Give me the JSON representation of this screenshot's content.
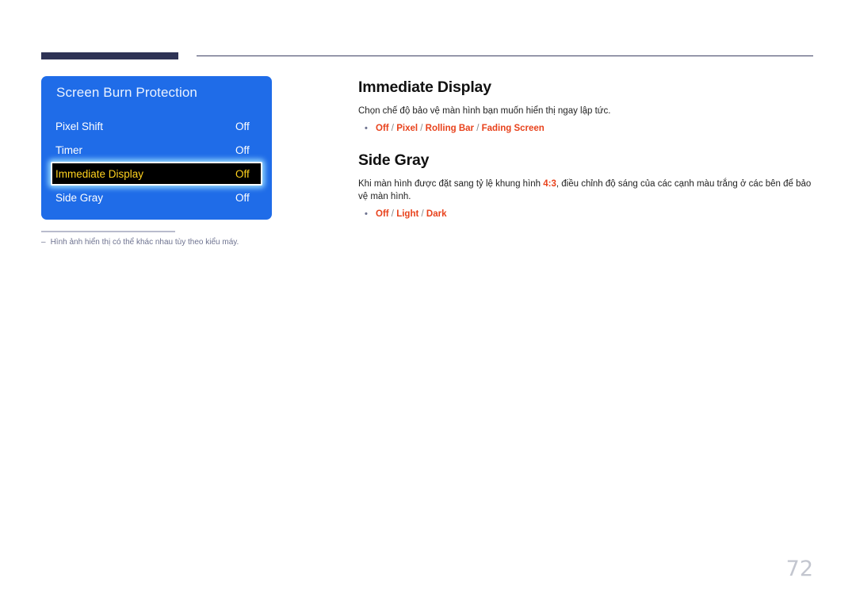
{
  "page": {
    "number": "72"
  },
  "osd": {
    "title": "Screen Burn Protection",
    "items": [
      {
        "label": "Pixel Shift",
        "value": "Off",
        "selected": false
      },
      {
        "label": "Timer",
        "value": "Off",
        "selected": false
      },
      {
        "label": "Immediate Display",
        "value": "Off",
        "selected": true
      },
      {
        "label": "Side Gray",
        "value": "Off",
        "selected": false
      }
    ],
    "colors": {
      "panel_blue": "#1f6ce8",
      "selected_background": "#000000",
      "selected_text": "#ffd21e",
      "selected_border": "#ffffff"
    }
  },
  "note": {
    "dash": "–",
    "text": "Hình ảnh hiển thị có thể khác nhau tùy theo kiểu máy."
  },
  "sections": [
    {
      "heading": "Immediate Display",
      "body_before": "Chọn chế độ bảo vệ màn hình bạn muốn hiển thị ngay lập tức.",
      "body_highlight": "",
      "body_after": "",
      "bullet": "•",
      "options": [
        "Off",
        "Pixel",
        "Rolling Bar",
        "Fading Screen"
      ],
      "separator": " / "
    },
    {
      "heading": "Side Gray",
      "body_before": "Khi màn hình được đặt sang tỷ lệ khung hình ",
      "body_highlight": "4:3",
      "body_after": ", điều chỉnh độ sáng của các cạnh màu trắng ở các bên để bảo vệ màn hình.",
      "bullet": "•",
      "options": [
        "Off",
        "Light",
        "Dark"
      ],
      "separator": " / "
    }
  ],
  "theme": {
    "rule_navy": "#2e3355",
    "option_red": "#e8421c",
    "note_gray": "#6e7390",
    "page_number_gray": "#c3c6cf"
  }
}
